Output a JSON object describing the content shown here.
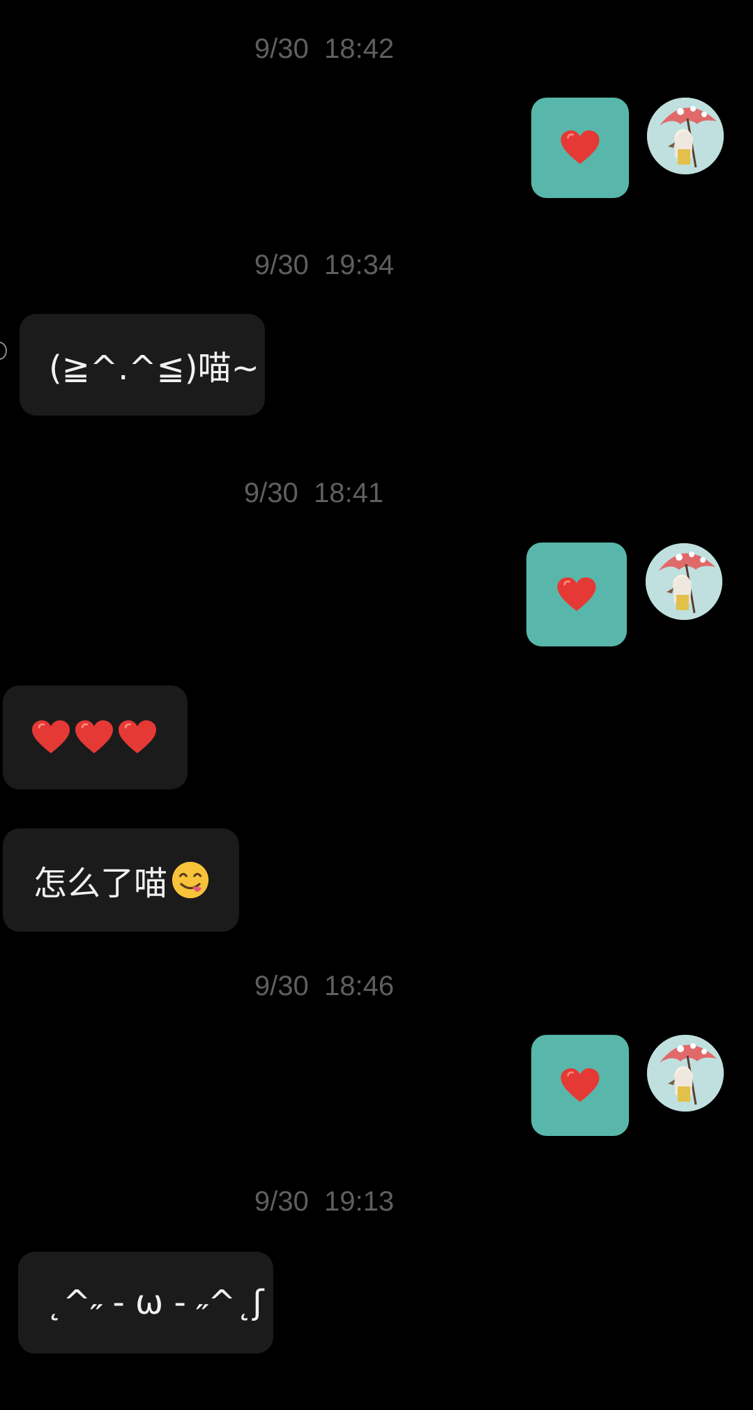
{
  "chat": {
    "messages": [
      {
        "kind": "timestamp",
        "text": "9/30  18:42"
      },
      {
        "kind": "outgoing",
        "content": "heart-icon",
        "sender_avatar": "avatar-girl-umbrella"
      },
      {
        "kind": "timestamp",
        "text": "9/30  19:34"
      },
      {
        "kind": "incoming",
        "text": "(≧^.^≦)喵~"
      },
      {
        "kind": "timestamp",
        "text": "9/30  18:41"
      },
      {
        "kind": "outgoing",
        "content": "heart-icon",
        "sender_avatar": "avatar-girl-umbrella"
      },
      {
        "kind": "incoming",
        "content": "heart-icon x3"
      },
      {
        "kind": "incoming",
        "text": "怎么了喵",
        "emoji": "face-savoring-food-icon"
      },
      {
        "kind": "timestamp",
        "text": "9/30  18:46"
      },
      {
        "kind": "outgoing",
        "content": "heart-icon",
        "sender_avatar": "avatar-girl-umbrella"
      },
      {
        "kind": "timestamp",
        "text": "9/30  19:13"
      },
      {
        "kind": "incoming",
        "text": "˛^˶ - ω - ˶^˛ʃ"
      }
    ]
  },
  "colors": {
    "background": "#000000",
    "incoming_bubble": "#1b1b1b",
    "outgoing_bubble": "#58b7aa",
    "timestamp_text": "#5f5f5f",
    "heart": "#e53935"
  }
}
